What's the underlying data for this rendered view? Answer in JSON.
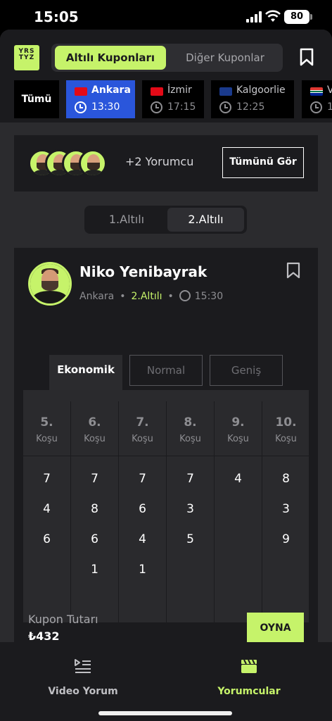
{
  "status_bar": {
    "time": "15:05",
    "battery": "80"
  },
  "header": {
    "logo_text": "YRS TYZ",
    "tabs": [
      {
        "label": "Altılı Kuponları",
        "active": true
      },
      {
        "label": "Diğer Kuponlar",
        "active": false
      }
    ]
  },
  "cities": [
    {
      "label": "Tümü",
      "time": ""
    },
    {
      "label": "Ankara",
      "time": "13:30",
      "flag": "tr",
      "selected": true
    },
    {
      "label": "İzmir",
      "time": "17:15",
      "flag": "tr"
    },
    {
      "label": "Kalgoorlie",
      "time": "12:25",
      "flag": "au"
    },
    {
      "label": "V",
      "time": "1",
      "flag": "za"
    }
  ],
  "commentators": {
    "extra_text": "+2 Yorumcu",
    "see_all_label": "Tümünü Gör"
  },
  "altili_tabs": [
    {
      "label": "1.Altılı",
      "active": false
    },
    {
      "label": "2.Altılı",
      "active": true
    }
  ],
  "coupon": {
    "name": "Niko Yenibayrak",
    "city": "Ankara",
    "altili": "2.Altılı",
    "time": "15:30",
    "type_tabs": [
      {
        "label": "Ekonomik",
        "active": true
      },
      {
        "label": "Normal",
        "active": false
      },
      {
        "label": "Geniş",
        "active": false
      }
    ],
    "races": [
      {
        "num": "5.",
        "label": "Koşu",
        "picks": [
          "7",
          "4",
          "6"
        ]
      },
      {
        "num": "6.",
        "label": "Koşu",
        "picks": [
          "7",
          "8",
          "6",
          "1"
        ]
      },
      {
        "num": "7.",
        "label": "Koşu",
        "picks": [
          "7",
          "6",
          "4",
          "1"
        ]
      },
      {
        "num": "8.",
        "label": "Koşu",
        "picks": [
          "7",
          "3",
          "5"
        ]
      },
      {
        "num": "9.",
        "label": "Koşu",
        "picks": [
          "4"
        ]
      },
      {
        "num": "10.",
        "label": "Koşu",
        "picks": [
          "8",
          "3",
          "9"
        ]
      }
    ],
    "amount_label": "Kupon Tutarı",
    "amount_value": "₺432",
    "play_label": "OYNA"
  },
  "bottom_nav": [
    {
      "label": "Video Yorum",
      "active": false
    },
    {
      "label": "Yorumcular",
      "active": true
    }
  ],
  "colors": {
    "accent": "#c6f36a",
    "selected_city": "#2a56db",
    "background": "#2b2b2e",
    "card": "#1b1b1e"
  }
}
